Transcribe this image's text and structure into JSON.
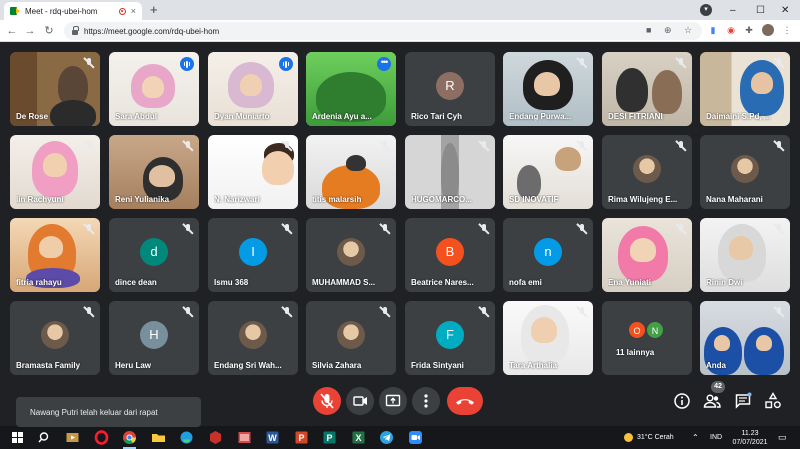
{
  "browser": {
    "tab_title": "Meet - rdq-ubei-hom",
    "new_tab": "+",
    "tab_close": "×",
    "url": "https://meet.google.com/rdq-ubei-hom",
    "window_buttons": {
      "minimize": "–",
      "maximize": "☐",
      "close": "✕"
    }
  },
  "participants": [
    {
      "name": "De Rose",
      "type": "video",
      "mic": "off",
      "scene": "bookshelf"
    },
    {
      "name": "Sara Abdul",
      "type": "video",
      "mic": "speaking",
      "scene": "hijab-pink"
    },
    {
      "name": "Dyan Muniarto",
      "type": "video",
      "mic": "speaking",
      "scene": "hijab-light"
    },
    {
      "name": "Ardenia Ayu a...",
      "type": "video",
      "mic": "more",
      "scene": "green",
      "active": true
    },
    {
      "name": "Rico Tari Cyh",
      "type": "avatar",
      "initial": "R",
      "color": "#8d6e63",
      "mic": "none"
    },
    {
      "name": "Endang Purwa...",
      "type": "video",
      "mic": "off",
      "scene": "hijab-black"
    },
    {
      "name": "DESI FITRIANI",
      "type": "video",
      "mic": "off",
      "scene": "duo"
    },
    {
      "name": "Daimaini S.Pd, ...",
      "type": "video",
      "mic": "off",
      "scene": "shelf-blue"
    },
    {
      "name": "Iin Rachyuni",
      "type": "video",
      "mic": "off",
      "scene": "hijab-pink2"
    },
    {
      "name": "Reni Yulianika",
      "type": "video",
      "mic": "off",
      "scene": "room-warm"
    },
    {
      "name": "N. Narizwari",
      "type": "video",
      "mic": "off",
      "scene": "child"
    },
    {
      "name": "titis malarsih",
      "type": "video",
      "mic": "off",
      "scene": "orange"
    },
    {
      "name": "HUGOMARCO...",
      "type": "video",
      "mic": "off",
      "scene": "door"
    },
    {
      "name": "SD INOVATIF",
      "type": "video",
      "mic": "off",
      "scene": "room-white"
    },
    {
      "name": "Rima Wilujeng E...",
      "type": "photo",
      "mic": "off"
    },
    {
      "name": "Nana Maharani",
      "type": "photo",
      "mic": "off"
    },
    {
      "name": "fitria rahayu",
      "type": "video",
      "mic": "off",
      "scene": "hijab-orange"
    },
    {
      "name": "dince dean",
      "type": "avatar",
      "initial": "d",
      "color": "#00897b",
      "mic": "off"
    },
    {
      "name": "Ismu 368",
      "type": "avatar",
      "initial": "I",
      "color": "#039be5",
      "mic": "off"
    },
    {
      "name": "MUHAMMAD S...",
      "type": "photo",
      "mic": "off"
    },
    {
      "name": "Beatrice Nares...",
      "type": "avatar",
      "initial": "B",
      "color": "#f4511e",
      "mic": "off"
    },
    {
      "name": "nofa emi",
      "type": "avatar",
      "initial": "n",
      "color": "#039be5",
      "mic": "off"
    },
    {
      "name": "Ena Yuniati",
      "type": "video",
      "mic": "off",
      "scene": "hijab-pink3"
    },
    {
      "name": "Rinin Dwi",
      "type": "video",
      "mic": "off",
      "scene": "hijab-white"
    },
    {
      "name": "Bramasta Family",
      "type": "photo",
      "mic": "off"
    },
    {
      "name": "Heru Law",
      "type": "avatar",
      "initial": "H",
      "color": "#78909c",
      "mic": "off"
    },
    {
      "name": "Endang Sri Wah...",
      "type": "photo",
      "mic": "off"
    },
    {
      "name": "Silvia Zahara",
      "type": "photo",
      "mic": "off"
    },
    {
      "name": "Frida Sintyani",
      "type": "avatar",
      "initial": "F",
      "color": "#00acc1",
      "mic": "off"
    },
    {
      "name": "Tara Arthalia",
      "type": "video",
      "mic": "off",
      "scene": "hijab-white2"
    },
    {
      "name": "11 lainnya",
      "type": "others",
      "initials": [
        "O",
        "N"
      ],
      "colors": [
        "#f4511e",
        "#43a047"
      ],
      "mic": "none"
    },
    {
      "name": "Anda",
      "type": "video",
      "mic": "off",
      "scene": "self"
    }
  ],
  "controls": {
    "people_count": "42",
    "toast": "Nawang Putri telah keluar dari rapat"
  },
  "taskbar": {
    "weather": "31°C Cerah",
    "language": "IND",
    "time": "11.23",
    "date": "07/07/2021"
  }
}
